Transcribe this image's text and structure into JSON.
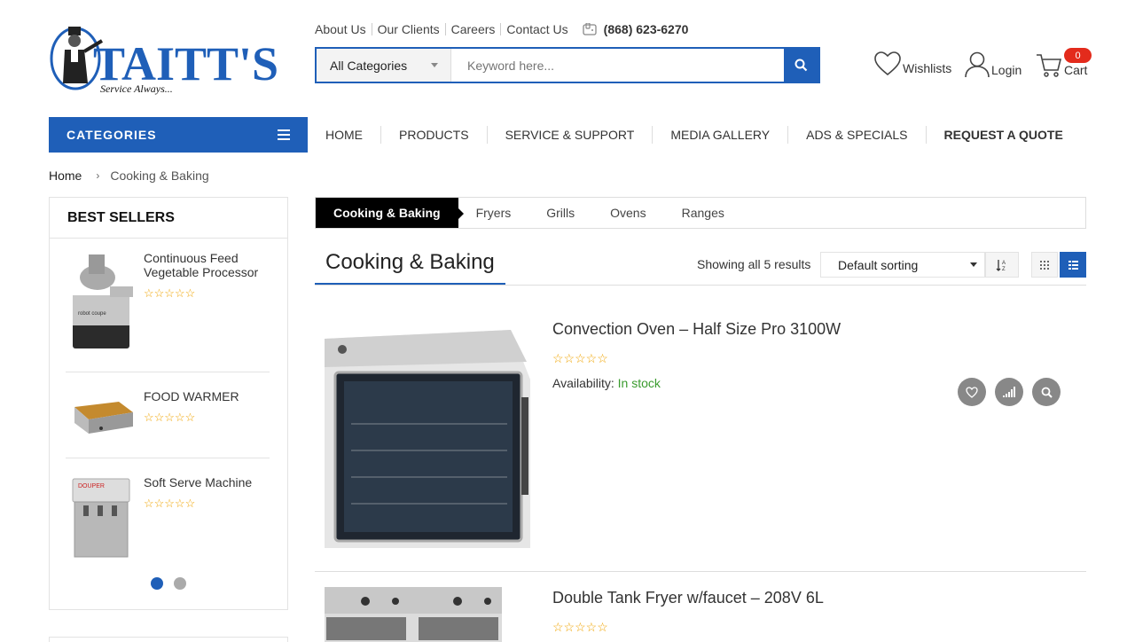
{
  "brand": {
    "name": "TAITT'S",
    "tagline": "Service Always...",
    "color": "#1f5fb8"
  },
  "toplinks": [
    "About Us",
    "Our Clients",
    "Careers",
    "Contact Us"
  ],
  "phone": "(868) 623-6270",
  "search": {
    "category": "All Categories",
    "placeholder": "Keyword here..."
  },
  "header": {
    "wishlists": "Wishlists",
    "login": "Login",
    "cart": "Cart",
    "cart_count": "0"
  },
  "nav": {
    "categories_label": "CATEGORIES",
    "items": [
      "HOME",
      "PRODUCTS",
      "SERVICE & SUPPORT",
      "MEDIA GALLERY",
      "ADS & SPECIALS",
      "REQUEST A QUOTE"
    ]
  },
  "breadcrumb": {
    "home": "Home",
    "separator": "›",
    "current": "Cooking & Baking"
  },
  "sidebar": {
    "title": "Best Sellers",
    "items": [
      {
        "name": "Continuous Feed Vegetable Processor",
        "stars": "☆☆☆☆☆"
      },
      {
        "name": "FOOD WARMER",
        "stars": "☆☆☆☆☆"
      },
      {
        "name": "Soft Serve Machine",
        "stars": "☆☆☆☆☆"
      }
    ]
  },
  "subtabs": [
    "Cooking & Baking",
    "Fryers",
    "Grills",
    "Ovens",
    "Ranges"
  ],
  "listing": {
    "title": "Cooking & Baking",
    "results": "Showing all 5 results",
    "sort": "Default sorting"
  },
  "products": [
    {
      "title": "Convection Oven – Half Size Pro 3100W",
      "stars": "☆☆☆☆☆",
      "availability_label": "Availability:",
      "availability": "In stock"
    },
    {
      "title": "Double Tank Fryer w/faucet – 208V 6L",
      "stars": "☆☆☆☆☆"
    }
  ]
}
